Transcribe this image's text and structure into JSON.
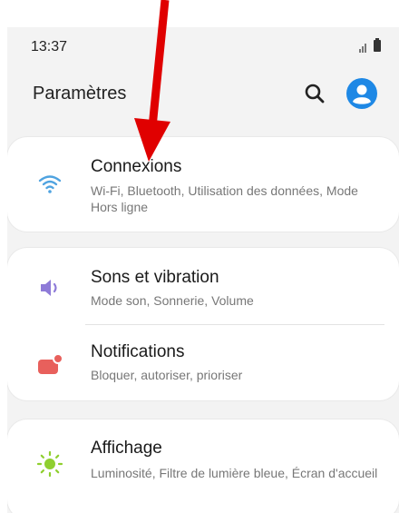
{
  "status_bar": {
    "time": "13:37"
  },
  "header": {
    "title": "Paramètres",
    "search_icon": "search-icon",
    "account_icon": "account-icon"
  },
  "items": [
    {
      "title": "Connexions",
      "subtitle": "Wi-Fi, Bluetooth, Utilisation des données, Mode Hors ligne",
      "icon": "wifi-icon",
      "icon_color": "#4fa3e0"
    },
    {
      "title": "Sons et vibration",
      "subtitle": "Mode son, Sonnerie, Volume",
      "icon": "volume-icon",
      "icon_color": "#8e7bd8"
    },
    {
      "title": "Notifications",
      "subtitle": "Bloquer, autoriser, prioriser",
      "icon": "notification-icon",
      "icon_color": "#e8605c"
    },
    {
      "title": "Affichage",
      "subtitle": "Luminosité, Filtre de lumière bleue, Écran d'accueil",
      "icon": "brightness-icon",
      "icon_color": "#8fcf2f"
    }
  ],
  "colors": {
    "accent": "#1e88e5",
    "annotation_arrow": "#e00000",
    "background": "#f3f3f3",
    "card": "#ffffff"
  }
}
